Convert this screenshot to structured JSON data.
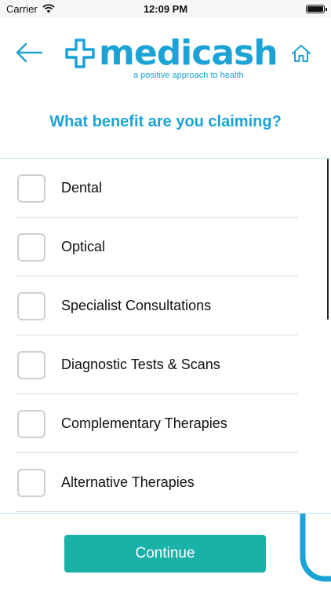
{
  "status_bar": {
    "carrier": "Carrier",
    "time": "12:09 PM"
  },
  "header": {
    "logo_text": "medicash",
    "logo_tagline": "a positive approach to health",
    "back_icon": "arrow-left-icon",
    "home_icon": "home-icon"
  },
  "question": "What benefit are you claiming?",
  "benefits": [
    {
      "label": "Dental",
      "checked": false
    },
    {
      "label": "Optical",
      "checked": false
    },
    {
      "label": "Specialist Consultations",
      "checked": false
    },
    {
      "label": "Diagnostic Tests & Scans",
      "checked": false
    },
    {
      "label": "Complementary Therapies",
      "checked": false
    },
    {
      "label": "Alternative Therapies",
      "checked": false
    }
  ],
  "footer": {
    "continue_label": "Continue"
  },
  "colors": {
    "brand_blue": "#1ba3d6",
    "button_teal": "#1ab1a8"
  }
}
